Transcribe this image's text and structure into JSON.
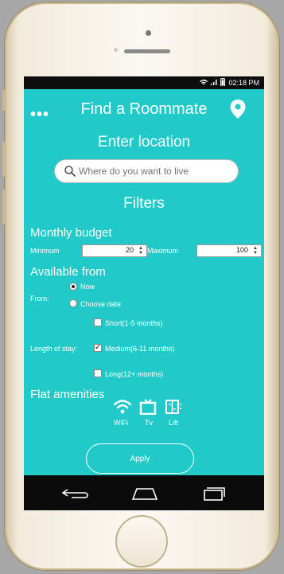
{
  "status": {
    "time": "02:18 PM"
  },
  "header": {
    "title": "Find a Roommate",
    "menu_glyph": "•••"
  },
  "location": {
    "heading": "Enter location",
    "placeholder": "Where do you want to live"
  },
  "filters": {
    "heading": "Filters",
    "budget": {
      "heading": "Monthly budget",
      "min_label": "Minimum",
      "min_value": "20",
      "max_label": "Maximum",
      "max_value": "100"
    },
    "available": {
      "heading": "Available from",
      "from_label": "From:",
      "option_now": "Now",
      "option_choose": "Choose date",
      "selected": "Now"
    },
    "stay": {
      "label": "Length of stay:",
      "short": "Short(1-5 months)",
      "medium": "Medium(6-11 months)",
      "long": "Long(12+ months)",
      "checked": "Medium(6-11 months)"
    },
    "amenities": {
      "heading": "Flat amenities",
      "items": [
        {
          "label": "WiFi",
          "icon": "wifi-icon"
        },
        {
          "label": "Tv",
          "icon": "tv-icon"
        },
        {
          "label": "Lift",
          "icon": "lift-icon"
        }
      ]
    },
    "apply_label": "Apply"
  },
  "colors": {
    "accent": "#21c9c9",
    "bar": "#0b0b0b"
  }
}
